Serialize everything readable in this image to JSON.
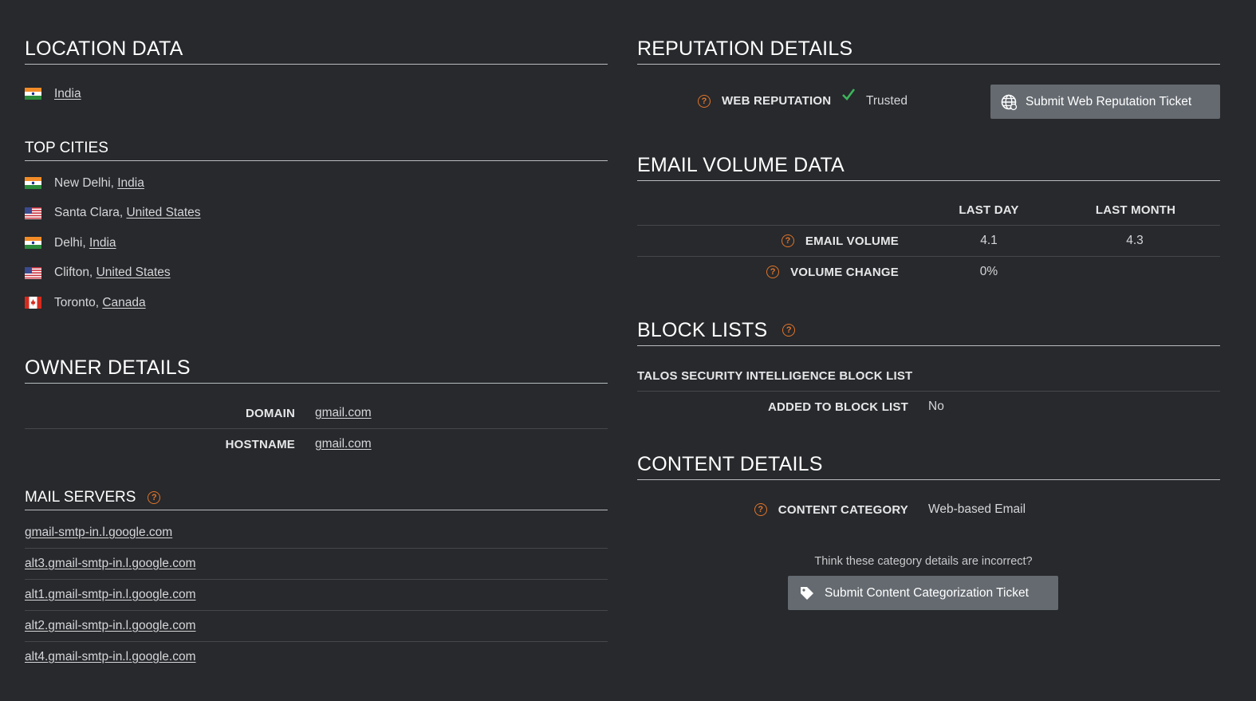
{
  "location": {
    "heading": "LOCATION DATA",
    "country": "India"
  },
  "top_cities": {
    "heading": "TOP CITIES",
    "items": [
      {
        "city": "New Delhi, ",
        "country": "India",
        "flag": "in-flag-icon"
      },
      {
        "city": "Santa Clara, ",
        "country": "United States",
        "flag": "us-flag-icon"
      },
      {
        "city": "Delhi, ",
        "country": "India",
        "flag": "in-flag-icon"
      },
      {
        "city": "Clifton, ",
        "country": "United States",
        "flag": "us-flag-icon"
      },
      {
        "city": "Toronto, ",
        "country": "Canada",
        "flag": "ca-flag-icon"
      }
    ]
  },
  "owner": {
    "heading": "OWNER DETAILS",
    "domain_label": "DOMAIN",
    "domain_value": "gmail.com",
    "hostname_label": "HOSTNAME",
    "hostname_value": "gmail.com"
  },
  "mail_servers": {
    "heading": "MAIL SERVERS",
    "items": [
      "gmail-smtp-in.l.google.com",
      "alt3.gmail-smtp-in.l.google.com",
      "alt1.gmail-smtp-in.l.google.com",
      "alt2.gmail-smtp-in.l.google.com",
      "alt4.gmail-smtp-in.l.google.com"
    ]
  },
  "reputation": {
    "heading": "REPUTATION DETAILS",
    "web_label": "WEB REPUTATION",
    "web_value": "Trusted",
    "submit_label": "Submit Web Reputation Ticket"
  },
  "email_volume": {
    "heading": "EMAIL VOLUME DATA",
    "col_last_day": "LAST DAY",
    "col_last_month": "LAST MONTH",
    "rows": [
      {
        "label": "EMAIL VOLUME",
        "last_day": "4.1",
        "last_month": "4.3"
      },
      {
        "label": "VOLUME CHANGE",
        "last_day": "0%",
        "last_month": ""
      }
    ]
  },
  "block_lists": {
    "heading": "BLOCK LISTS",
    "list_name": "TALOS SECURITY INTELLIGENCE BLOCK LIST",
    "added_label": "ADDED TO BLOCK LIST",
    "added_value": "No"
  },
  "content": {
    "heading": "CONTENT DETAILS",
    "category_label": "CONTENT CATEGORY",
    "category_value": "Web-based Email",
    "prompt": "Think these category details are incorrect?",
    "submit_label": "Submit Content Categorization Ticket"
  },
  "colors": {
    "background": "#27292c",
    "accent_help": "#e2742a",
    "trusted_check": "#3cb55a",
    "button_bg": "#646a70"
  }
}
